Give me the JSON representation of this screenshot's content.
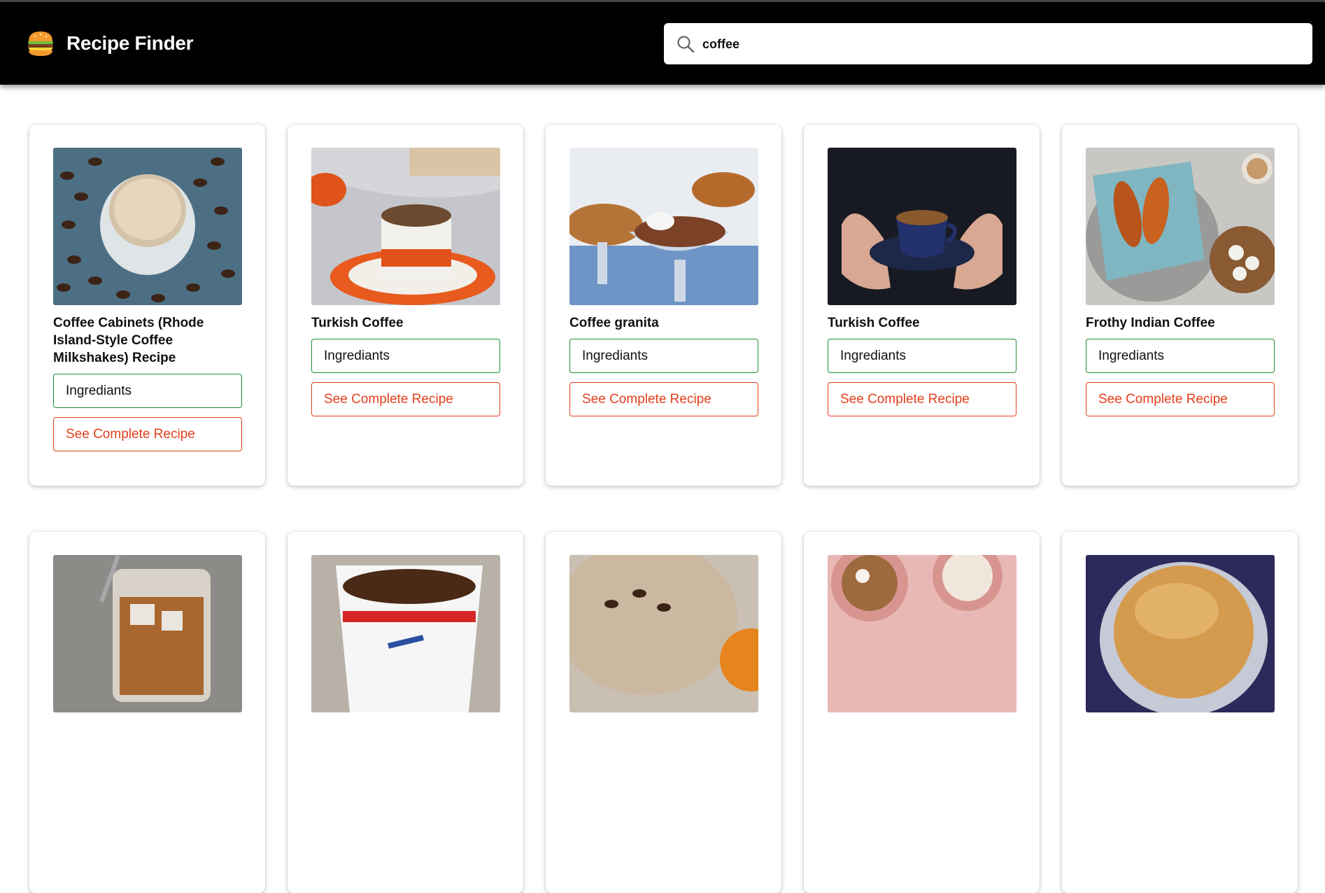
{
  "header": {
    "app_title": "Recipe Finder",
    "logo_icon": "burger-icon"
  },
  "search": {
    "value": "coffee",
    "icon": "search-icon"
  },
  "colors": {
    "header_bg": "#000000",
    "ingredients_border": "#1e8c2a",
    "recipe_accent": "#e2401c"
  },
  "recipes": [
    {
      "title": "Coffee Cabinets (Rhode Island-Style Coffee Milkshakes) Recipe",
      "ingredients_label": "Ingrediants",
      "recipe_label": "See Complete Recipe",
      "image": "iced-coffee-milkshake-with-beans"
    },
    {
      "title": "Turkish Coffee",
      "ingredients_label": "Ingrediants",
      "recipe_label": "See Complete Recipe",
      "image": "turkish-coffee-cup-orange-saucer"
    },
    {
      "title": "Coffee granita",
      "ingredients_label": "Ingrediants",
      "recipe_label": "See Complete Recipe",
      "image": "granita-in-glass-bowls"
    },
    {
      "title": "Turkish Coffee",
      "ingredients_label": "Ingrediants",
      "recipe_label": "See Complete Recipe",
      "image": "hands-holding-blue-coffee-cup"
    },
    {
      "title": "Frothy Indian Coffee",
      "ingredients_label": "Ingrediants",
      "recipe_label": "See Complete Recipe",
      "image": "croissants-and-coffee"
    },
    {
      "title": "",
      "ingredients_label": "",
      "recipe_label": "",
      "image": "iced-coffee-glass"
    },
    {
      "title": "",
      "ingredients_label": "",
      "recipe_label": "",
      "image": "paper-coffee-cup"
    },
    {
      "title": "",
      "ingredients_label": "",
      "recipe_label": "",
      "image": "frothy-coffee-with-beans"
    },
    {
      "title": "",
      "ingredients_label": "",
      "recipe_label": "",
      "image": "pink-cups-desserts"
    },
    {
      "title": "",
      "ingredients_label": "",
      "recipe_label": "",
      "image": "dalgona-coffee"
    }
  ]
}
